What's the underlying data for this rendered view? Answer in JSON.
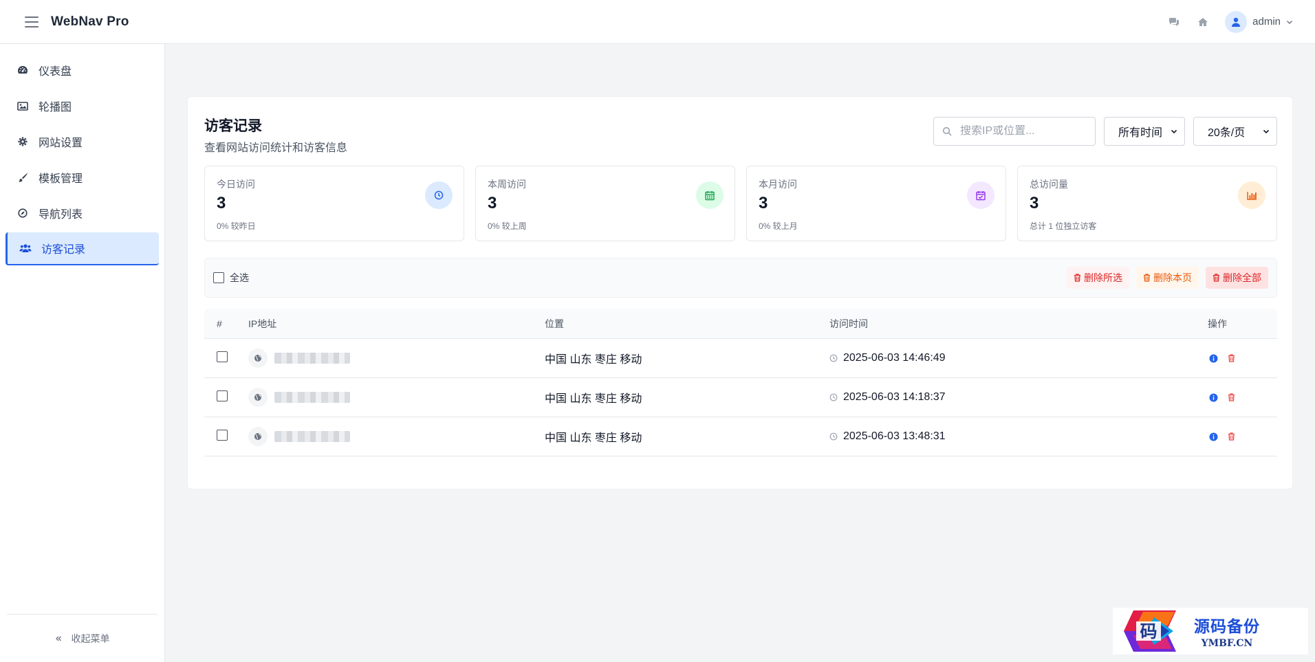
{
  "header": {
    "brand": "WebNav Pro",
    "username": "admin",
    "icons": [
      "comments-icon",
      "home-icon",
      "user-icon"
    ]
  },
  "sidebar": {
    "items": [
      {
        "label": "仪表盘",
        "icon": "dashboard-icon"
      },
      {
        "label": "轮播图",
        "icon": "image-icon"
      },
      {
        "label": "网站设置",
        "icon": "gear-icon"
      },
      {
        "label": "模板管理",
        "icon": "brush-icon"
      },
      {
        "label": "导航列表",
        "icon": "compass-icon"
      },
      {
        "label": "访客记录",
        "icon": "users-icon",
        "active": true
      }
    ],
    "collapse_label": "收起菜单"
  },
  "page": {
    "title": "访客记录",
    "subtitle": "查看网站访问统计和访客信息",
    "search_placeholder": "搜索IP或位置...",
    "time_filter": "所有时间",
    "page_size": "20条/页"
  },
  "stats": [
    {
      "label": "今日访问",
      "value": "3",
      "note": "0% 较昨日",
      "icon": "clock-icon",
      "color": "#2563eb",
      "bg": "#dbeafe"
    },
    {
      "label": "本周访问",
      "value": "3",
      "note": "0% 较上周",
      "icon": "calendar-icon",
      "color": "#16a34a",
      "bg": "#dcfce7"
    },
    {
      "label": "本月访问",
      "value": "3",
      "note": "0% 较上月",
      "icon": "calendar-check-icon",
      "color": "#9333ea",
      "bg": "#f3e8ff"
    },
    {
      "label": "总访问量",
      "value": "3",
      "note": "总计 1 位独立访客",
      "icon": "bar-chart-icon",
      "color": "#ea580c",
      "bg": "#ffedd5"
    }
  ],
  "bulk": {
    "select_all": "全选",
    "delete_selected": "删除所选",
    "delete_page": "删除本页",
    "delete_all": "删除全部"
  },
  "table": {
    "headers": [
      "#",
      "IP地址",
      "位置",
      "访问时间",
      "操作"
    ],
    "rows": [
      {
        "location": "中国 山东 枣庄 移动",
        "time": "2025-06-03 14:46:49"
      },
      {
        "location": "中国 山东 枣庄 移动",
        "time": "2025-06-03 14:18:37"
      },
      {
        "location": "中国 山东 枣庄 移动",
        "time": "2025-06-03 13:48:31"
      }
    ]
  },
  "watermark": {
    "cn": "源码备份",
    "en": "YMBF.CN",
    "logo_char": "码"
  }
}
